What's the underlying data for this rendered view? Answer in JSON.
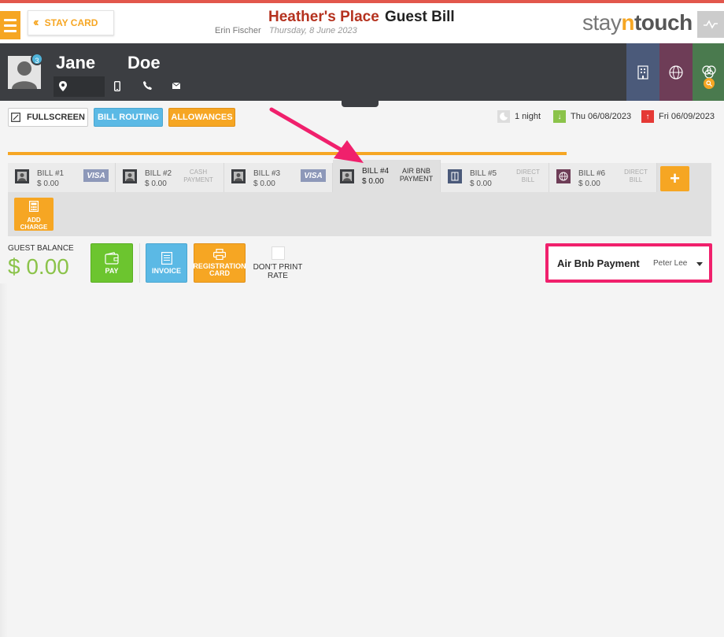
{
  "header": {
    "back_label": "STAY CARD",
    "hotel_name": "Heather's Place",
    "page_title": "Guest Bill",
    "user_name": "Erin Fischer",
    "date": "Thursday, 8 June 2023",
    "logo_stay": "stay",
    "logo_n": "n",
    "logo_touch": "touch"
  },
  "guest": {
    "first_name": "Jane",
    "last_name": "Doe",
    "notification_count": "3"
  },
  "toolbar": {
    "fullscreen_label": "FULLSCREEN",
    "bill_routing_label": "BILL ROUTING",
    "allowances_label": "ALLOWANCES"
  },
  "stay": {
    "nights": "1 night",
    "arrival": "Thu 06/08/2023",
    "departure": "Fri 06/09/2023"
  },
  "bills": [
    {
      "name": "BILL #1",
      "amount": "$ 0.00",
      "meta": "VISA",
      "meta_type": "card",
      "icon": "avatar-icon"
    },
    {
      "name": "BILL #2",
      "amount": "$ 0.00",
      "meta": "CASH PAYMENT",
      "meta_type": "text",
      "icon": "avatar-icon"
    },
    {
      "name": "BILL #3",
      "amount": "$ 0.00",
      "meta": "VISA",
      "meta_type": "card",
      "icon": "avatar-icon"
    },
    {
      "name": "BILL #4",
      "amount": "$ 0.00",
      "meta": "AIR BNB PAYMENT",
      "meta_type": "text",
      "icon": "avatar-icon",
      "active": true
    },
    {
      "name": "BILL #5",
      "amount": "$ 0.00",
      "meta": "DIRECT BILL",
      "meta_type": "text",
      "icon": "building-icon"
    },
    {
      "name": "BILL #6",
      "amount": "$ 0.00",
      "meta": "DIRECT BILL",
      "meta_type": "text",
      "icon": "globe-icon"
    }
  ],
  "add_charge_label": "ADD CHARGE",
  "balance": {
    "label": "GUEST BALANCE",
    "value": "$ 0.00"
  },
  "actions": {
    "pay_label": "PAY",
    "invoice_label": "INVOICE",
    "registration_label": "REGISTRATION CARD",
    "dont_print_rate_label": "DON'T PRINT RATE"
  },
  "payment_selector": {
    "type": "Air Bnb Payment",
    "person": "Peter Lee"
  },
  "colors": {
    "accent_orange": "#f6a623",
    "accent_blue": "#5bb9e5",
    "pay_green": "#6cc52f",
    "hotel_red": "#b5321f",
    "annotation_pink": "#f0206c",
    "balance_green": "#8bc34a"
  }
}
